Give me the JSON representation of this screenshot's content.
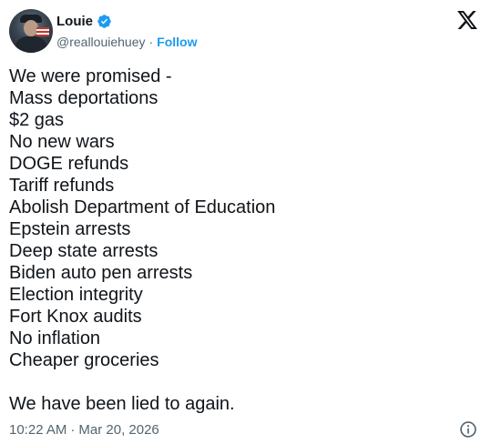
{
  "user": {
    "name": "Louie",
    "handle": "@reallouiehuey",
    "separator": "·",
    "follow_label": "Follow"
  },
  "tweet": {
    "lines": [
      "We were promised -",
      "Mass deportations",
      "$2 gas",
      "No new wars",
      "DOGE refunds",
      "Tariff refunds",
      "Abolish Department of Education",
      "Epstein arrests",
      "Deep state arrests",
      "Biden auto pen arrests",
      "Election integrity",
      "Fort Knox audits",
      "No inflation",
      "Cheaper groceries"
    ],
    "closing": "We have been lied to again."
  },
  "meta": {
    "time": "10:22 AM",
    "separator": "·",
    "date": "Mar 20, 2026"
  },
  "icons": {
    "verified": "verified-badge-icon",
    "brand": "x-logo-icon",
    "info": "info-icon"
  },
  "colors": {
    "accent": "#1d9bf0",
    "text": "#0f1419",
    "muted": "#536471"
  }
}
